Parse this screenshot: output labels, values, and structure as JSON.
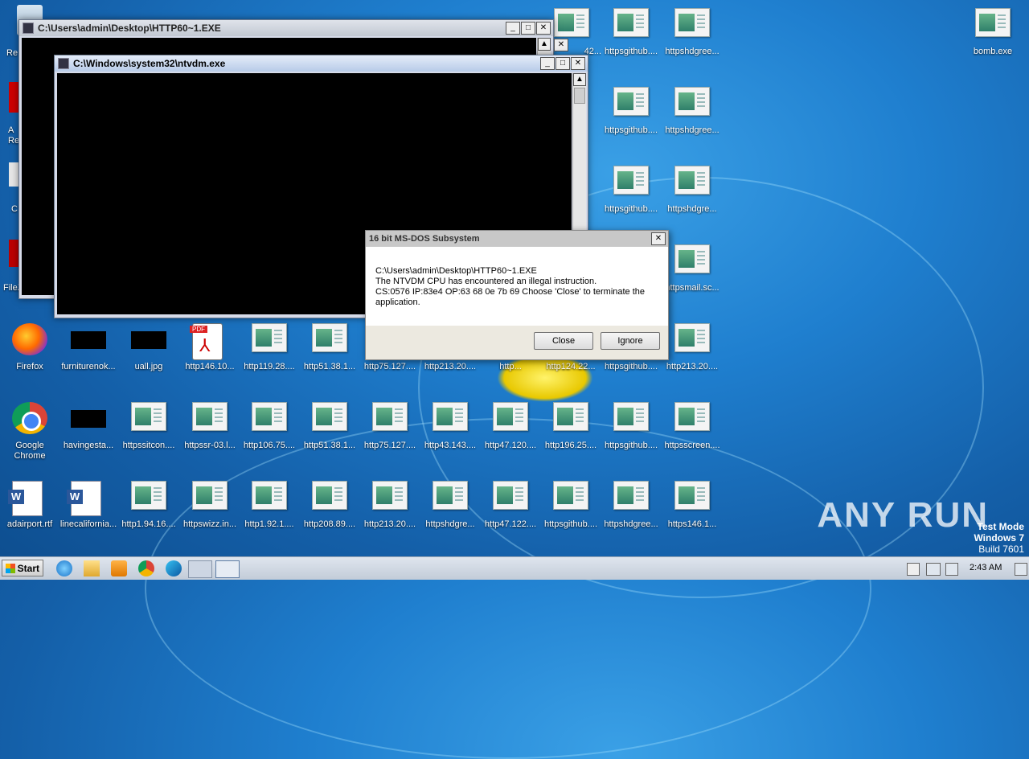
{
  "desktop": {
    "icons_col1": [
      {
        "label": "Re",
        "kind": "recycle"
      },
      {
        "label": "A Re",
        "kind": "acrobat"
      },
      {
        "label": "C",
        "kind": "app"
      },
      {
        "label": "FileZilla C",
        "kind": "filezilla"
      },
      {
        "label": "Firefox",
        "kind": "firefox"
      },
      {
        "label": "Google Chrome",
        "kind": "chrome"
      },
      {
        "label": "adairport.rtf",
        "kind": "word"
      }
    ],
    "icons_top_right": [
      {
        "label": "42...",
        "kind": "html"
      },
      {
        "label": "httpsgithub....",
        "kind": "html"
      },
      {
        "label": "httpshdgree...",
        "kind": "html"
      },
      {
        "label": "bomb.exe",
        "kind": "html"
      }
    ],
    "icons_row2": [
      {
        "label": "httpsgithub....",
        "kind": "html"
      },
      {
        "label": "httpshdgree...",
        "kind": "html"
      }
    ],
    "icons_row3": [
      {
        "label": "httpsgithub....",
        "kind": "html"
      },
      {
        "label": "httpshdgre...",
        "kind": "html"
      }
    ],
    "icons_row4": [
      {
        "label": "httpsmail.sc...",
        "kind": "html"
      }
    ],
    "icons_row5": [
      {
        "label": "furniturenok...",
        "kind": "black"
      },
      {
        "label": "uall.jpg",
        "kind": "black"
      },
      {
        "label": "http146.10...",
        "kind": "pdf"
      },
      {
        "label": "http119.28....",
        "kind": "html"
      },
      {
        "label": "http51.38.1...",
        "kind": "html"
      },
      {
        "label": "http75.127....",
        "kind": "html"
      },
      {
        "label": "http213.20....",
        "kind": "html"
      },
      {
        "label": "http...",
        "kind": "html"
      },
      {
        "label": "http124.22...",
        "kind": "html"
      },
      {
        "label": "httpsgithub....",
        "kind": "html"
      },
      {
        "label": "http213.20....",
        "kind": "html"
      }
    ],
    "icons_row6": [
      {
        "label": "havingesta...",
        "kind": "black"
      },
      {
        "label": "httpssitcon....",
        "kind": "html"
      },
      {
        "label": "httpssr-03.l...",
        "kind": "html"
      },
      {
        "label": "http106.75....",
        "kind": "html"
      },
      {
        "label": "http51.38.1...",
        "kind": "html"
      },
      {
        "label": "http75.127....",
        "kind": "html"
      },
      {
        "label": "http43.143....",
        "kind": "html"
      },
      {
        "label": "http47.120....",
        "kind": "html"
      },
      {
        "label": "http196.25....",
        "kind": "html"
      },
      {
        "label": "httpsgithub....",
        "kind": "html"
      },
      {
        "label": "httpsscreen....",
        "kind": "html"
      }
    ],
    "icons_row7": [
      {
        "label": "linecalifornia...",
        "kind": "word"
      },
      {
        "label": "http1.94.16....",
        "kind": "html"
      },
      {
        "label": "httpswizz.in...",
        "kind": "html"
      },
      {
        "label": "http1.92.1....",
        "kind": "html"
      },
      {
        "label": "http208.89....",
        "kind": "html"
      },
      {
        "label": "http213.20....",
        "kind": "html"
      },
      {
        "label": "httpshdgre...",
        "kind": "html"
      },
      {
        "label": "http47.122....",
        "kind": "html"
      },
      {
        "label": "httpsgithub....",
        "kind": "html"
      },
      {
        "label": "httpshdgree...",
        "kind": "html"
      },
      {
        "label": "https146.1...",
        "kind": "html"
      }
    ]
  },
  "window_back": {
    "title": "C:\\Users\\admin\\Desktop\\HTTP60~1.EXE"
  },
  "window_front": {
    "title": "C:\\Windows\\system32\\ntvdm.exe"
  },
  "dialog": {
    "title": "16 bit MS-DOS Subsystem",
    "line1": "C:\\Users\\admin\\Desktop\\HTTP60~1.EXE",
    "line2": "The NTVDM CPU has encountered an illegal instruction.",
    "line3": "CS:0576 IP:83e4 OP:63 68 0e 7b 69 Choose 'Close' to terminate the application.",
    "close_label": "Close",
    "ignore_label": "Ignore"
  },
  "taskbar": {
    "start_label": "Start",
    "clock": "2:43 AM"
  },
  "watermark": "ANY RUN",
  "test_mode": {
    "line1": "Test Mode",
    "line2": "Windows 7",
    "line3": "Build 7601"
  },
  "colors": {
    "desktop_blue": "#1f7fcf",
    "console_bg": "#000000",
    "dialog_bg": "#ece9e0"
  }
}
